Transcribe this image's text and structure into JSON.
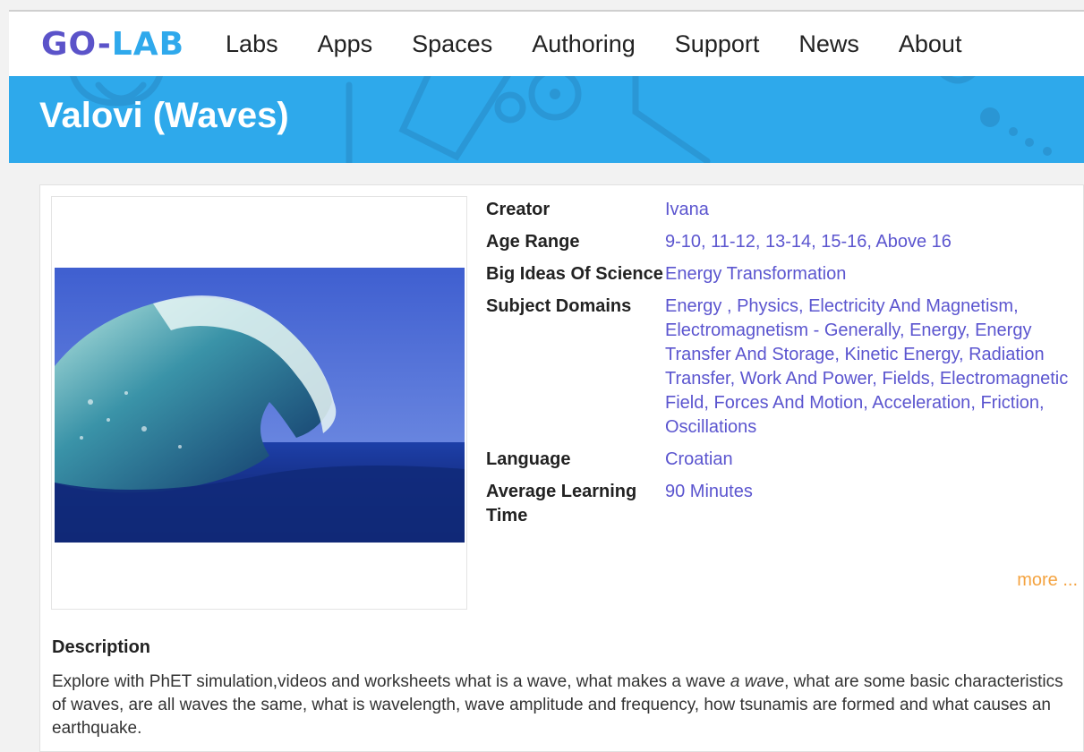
{
  "logo": {
    "go": "GO",
    "dash": "-",
    "lab": "LAB"
  },
  "nav": [
    "Labs",
    "Apps",
    "Spaces",
    "Authoring",
    "Support",
    "News",
    "About"
  ],
  "page": {
    "title": "Valovi (Waves)"
  },
  "meta": {
    "creator_label": "Creator",
    "creator": "Ivana",
    "age_label": "Age Range",
    "ages": [
      "9-10",
      "11-12",
      "13-14",
      "15-16",
      "Above 16"
    ],
    "big_ideas_label": "Big Ideas Of Science",
    "big_ideas": "Energy Transformation",
    "subjects_label": "Subject Domains",
    "subjects": [
      "Energy ",
      "Physics",
      "Electricity And Magnetism",
      "Electromagnetism - Generally",
      "Energy",
      "Energy Transfer And Storage",
      "Kinetic Energy",
      "Radiation Transfer",
      "Work And Power",
      "Fields",
      "Electromagnetic Field",
      "Forces And Motion",
      "Acceleration",
      "Friction",
      "Oscillations"
    ],
    "language_label": "Language",
    "language": "Croatian",
    "time_label": "Average Learning Time",
    "time": "90 Minutes",
    "more": "more ..."
  },
  "description": {
    "label": "Description",
    "part1": "Explore with PhET simulation,videos and worksheets what is a wave, what makes a wave ",
    "italic": "a wave",
    "part2": ", what are some basic characteristics of waves, are all waves the same, what is wavelength, wave amplitude and frequency, how tsunamis are formed and what causes an earthquake."
  },
  "colors": {
    "banner": "#2ea9eb",
    "link": "#5b55cf",
    "more": "#f4a340",
    "logo_primary": "#5b53c9",
    "logo_accent": "#2fa9ec"
  }
}
